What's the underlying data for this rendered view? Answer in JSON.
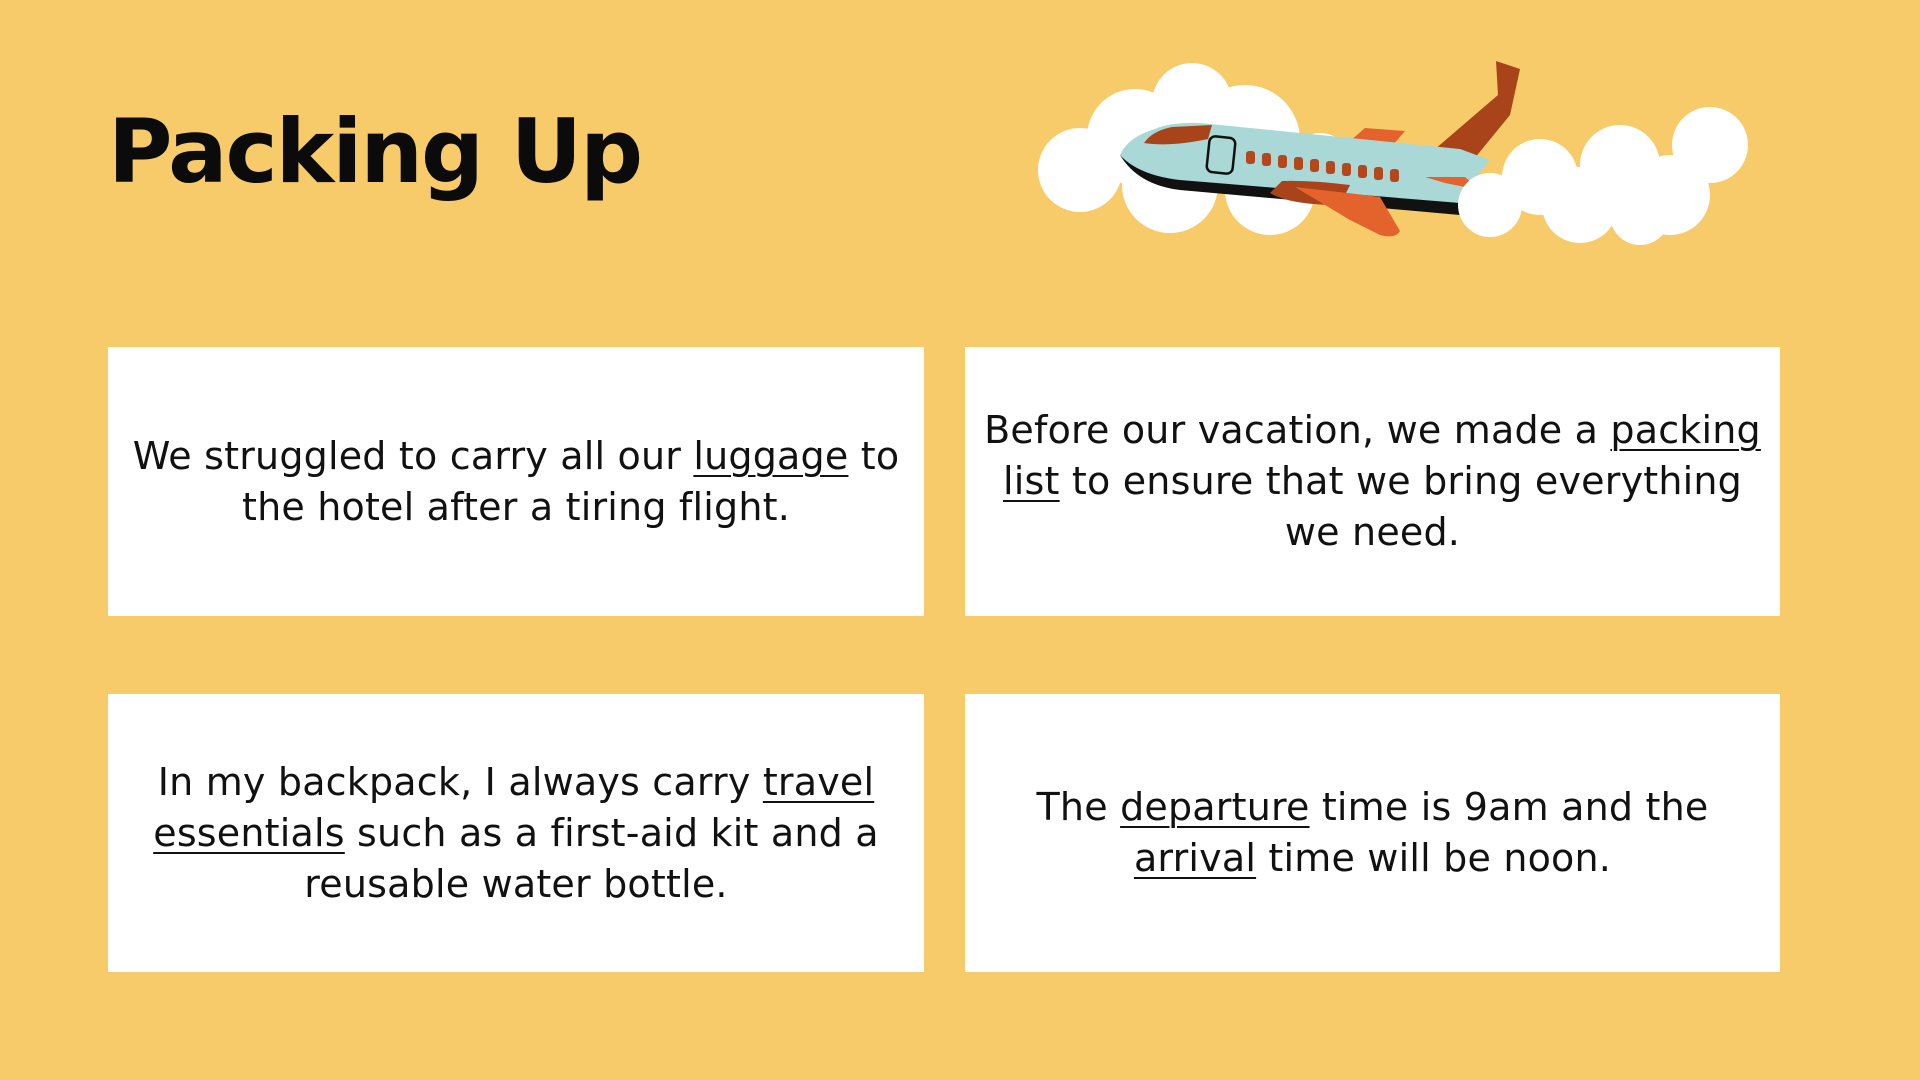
{
  "slide": {
    "title": "Packing Up",
    "background_color": "#F7CB6A"
  },
  "illustration": {
    "icons": [
      "cloud-icon",
      "airplane-icon"
    ],
    "colors": {
      "cloud": "#ffffff",
      "fuselage": "#A9D8D6",
      "tail": "#A8431A",
      "wing": "#E4622B",
      "belly": "#111111",
      "windows": "#B5471D"
    }
  },
  "cards": [
    {
      "id": "card-luggage",
      "segments": [
        {
          "text": "We struggled to carry all our ",
          "underline": false
        },
        {
          "text": "luggage",
          "underline": true
        },
        {
          "text": " to the hotel after a tiring flight.",
          "underline": false
        }
      ]
    },
    {
      "id": "card-packing-list",
      "segments": [
        {
          "text": "Before our vacation, we made a ",
          "underline": false
        },
        {
          "text": "packing list",
          "underline": true
        },
        {
          "text": " to ensure that we bring everything we need.",
          "underline": false
        }
      ]
    },
    {
      "id": "card-travel-essentials",
      "segments": [
        {
          "text": "In my backpack, I always carry ",
          "underline": false
        },
        {
          "text": "travel essentials",
          "underline": true
        },
        {
          "text": " such as a first-aid kit and a reusable water bottle.",
          "underline": false
        }
      ]
    },
    {
      "id": "card-departure-arrival",
      "segments": [
        {
          "text": "The ",
          "underline": false
        },
        {
          "text": "departure",
          "underline": true
        },
        {
          "text": " time is 9am and the ",
          "underline": false
        },
        {
          "text": "arrival",
          "underline": true
        },
        {
          "text": " time will be noon.",
          "underline": false
        }
      ]
    }
  ]
}
